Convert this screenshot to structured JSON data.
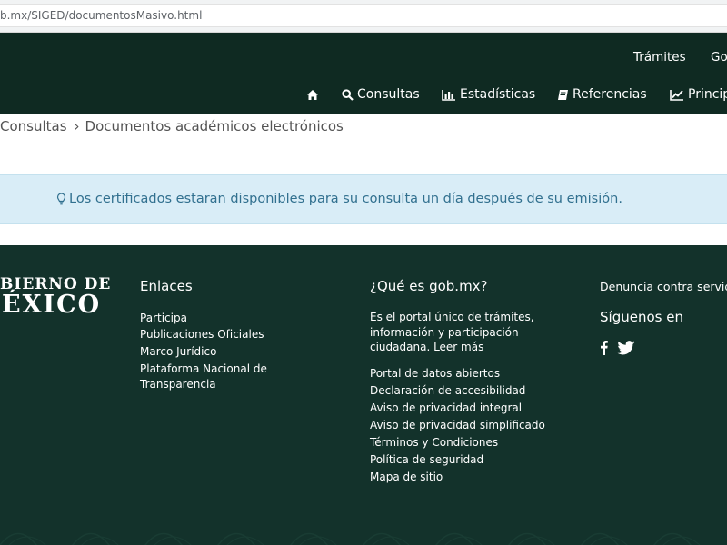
{
  "browser": {
    "url": "b.mx/SIGED/documentosMasivo.html"
  },
  "header": {
    "top_links": [
      "Trámites",
      "Gob"
    ],
    "nav": [
      {
        "icon": "home-icon",
        "label": ""
      },
      {
        "icon": "search-icon",
        "label": "Consultas"
      },
      {
        "icon": "bar-chart-icon",
        "label": "Estadísticas"
      },
      {
        "icon": "book-icon",
        "label": "Referencias"
      },
      {
        "icon": "line-chart-icon",
        "label": "Princip"
      }
    ]
  },
  "breadcrumb": {
    "items": [
      "Consultas",
      "Documentos académicos electrónicos"
    ],
    "separator": "›"
  },
  "alert": {
    "icon": "lightbulb-icon",
    "text": "Los certificados estaran disponibles para su consulta un día después de su emisión."
  },
  "footer": {
    "logo": {
      "line1": "BIERNO DE",
      "line2": "ÉXICO"
    },
    "enlaces": {
      "title": "Enlaces",
      "links": [
        "Participa",
        "Publicaciones Oficiales",
        "Marco Jurídico",
        "Plataforma Nacional de",
        "Transparencia"
      ]
    },
    "que_es": {
      "title": "¿Qué es gob.mx?",
      "description": "Es el portal único de trámites, información y participación ciudadana. Leer más",
      "links": [
        "Portal de datos abiertos",
        "Declaración de accesibilidad",
        "Aviso de privacidad integral",
        "Aviso de privacidad simplificado",
        "Términos y Condiciones",
        "Política de seguridad",
        "Mapa de sitio"
      ]
    },
    "right": {
      "denuncia": "Denuncia contra servid",
      "siguenos": "Síguenos en",
      "social": [
        "facebook-icon",
        "twitter-icon"
      ]
    }
  },
  "colors": {
    "header_bg": "#0f2a22",
    "footer_bg": "#13322b",
    "alert_bg": "#d9edf7",
    "alert_text": "#31708f"
  }
}
